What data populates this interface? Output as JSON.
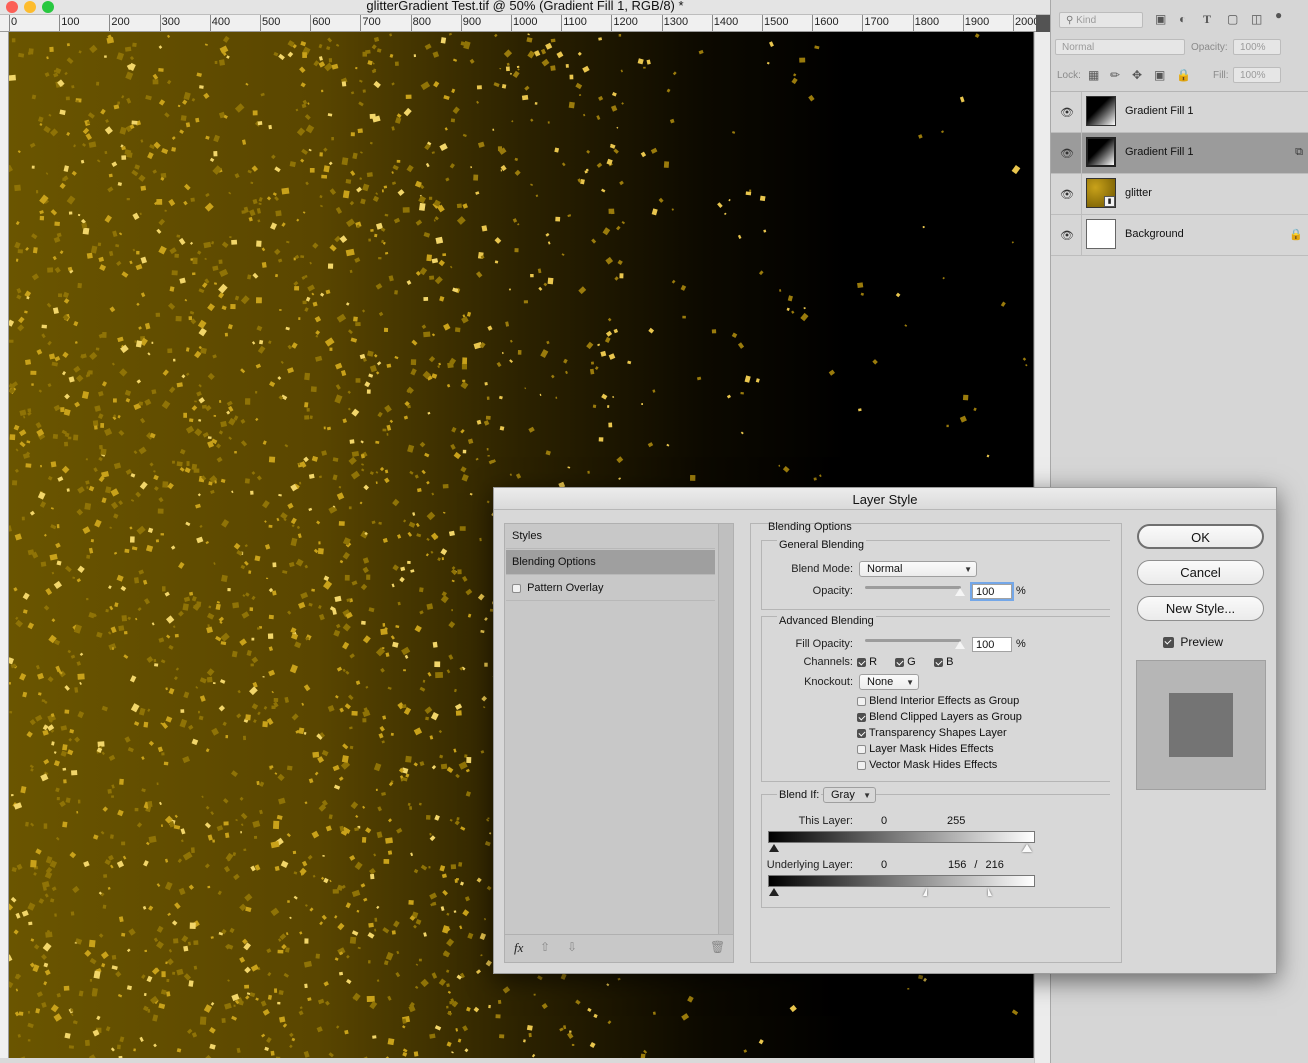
{
  "window": {
    "title": "glitterGradient Test.tif @ 50% (Gradient Fill 1, RGB/8) *",
    "ruler_labels": [
      "0",
      "100",
      "200",
      "300",
      "400",
      "500",
      "600",
      "700",
      "800",
      "900",
      "1000",
      "1100",
      "1200",
      "1300",
      "1400",
      "1500",
      "1600",
      "1700",
      "1800",
      "1900",
      "2000"
    ]
  },
  "layers_panel": {
    "kind_label": "Kind",
    "blend_mode": "Normal",
    "opacity_label": "Opacity:",
    "opacity_value": "100%",
    "lock_label": "Lock:",
    "fill_label": "Fill:",
    "fill_value": "100%",
    "layers": [
      {
        "name": "Gradient Fill 1",
        "selected": false
      },
      {
        "name": "Gradient Fill 1",
        "selected": true
      },
      {
        "name": "glitter",
        "selected": false
      },
      {
        "name": "Background",
        "selected": false
      }
    ]
  },
  "dialog": {
    "title": "Layer Style",
    "styles": [
      "Styles",
      "Blending Options",
      "Pattern Overlay"
    ],
    "blending_options_title": "Blending Options",
    "general_blending": {
      "title": "General Blending",
      "blend_mode_label": "Blend Mode:",
      "blend_mode": "Normal",
      "opacity_label": "Opacity:",
      "opacity": "100",
      "unit": "%"
    },
    "advanced_blending": {
      "title": "Advanced Blending",
      "fill_opacity_label": "Fill Opacity:",
      "fill_opacity": "100",
      "unit": "%",
      "channels_label": "Channels:",
      "channels": [
        "R",
        "G",
        "B"
      ],
      "knockout_label": "Knockout:",
      "knockout": "None",
      "options": [
        {
          "label": "Blend Interior Effects as Group",
          "checked": false
        },
        {
          "label": "Blend Clipped Layers as Group",
          "checked": true
        },
        {
          "label": "Transparency Shapes Layer",
          "checked": true
        },
        {
          "label": "Layer Mask Hides Effects",
          "checked": false
        },
        {
          "label": "Vector Mask Hides Effects",
          "checked": false
        }
      ]
    },
    "blend_if": {
      "label": "Blend If:",
      "value": "Gray",
      "this_layer_label": "This Layer:",
      "this_layer_min": "0",
      "this_layer_max": "255",
      "underlying_label": "Underlying Layer:",
      "underlying_min": "0",
      "underlying_split_low": "156",
      "underlying_sep": "/",
      "underlying_split_high": "216"
    },
    "buttons": {
      "ok": "OK",
      "cancel": "Cancel",
      "new_style": "New Style..."
    },
    "preview_label": "Preview",
    "footer_fx": "fx"
  }
}
